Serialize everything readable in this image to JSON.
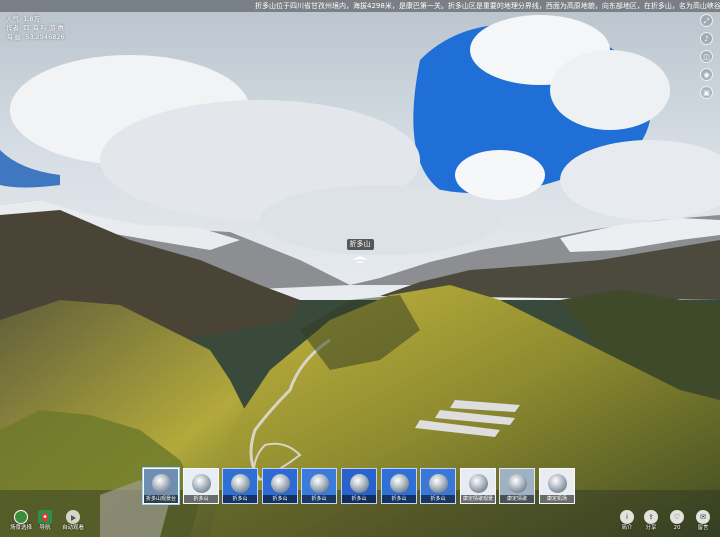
{
  "ticker": {
    "text": "折多山位于四川省甘孜州境内，海拔4298米，是康巴第一关。折多山区是重要的地理分界线，西面为高原地貌，向东部地区，在折多山，名为高山峡谷地貌，有大渡河，大雪山横亘在川西"
  },
  "stats": {
    "views": "人气: 1.8万",
    "author": "作者: 四 海 叫 游 惠",
    "altitude": "海 拔: 53.2946826"
  },
  "right_tools": [
    {
      "icon": "expand-icon",
      "glyph": "⤢"
    },
    {
      "icon": "music-icon",
      "glyph": "♪"
    },
    {
      "icon": "vr-icon",
      "glyph": "◫"
    },
    {
      "icon": "eye-icon",
      "glyph": "◉"
    },
    {
      "icon": "gyroscope-icon",
      "glyph": "▣"
    }
  ],
  "hotspot": {
    "label": "折多山"
  },
  "thumbnails": [
    {
      "label": "折多山观景台",
      "active": true,
      "color": "#6e8fb0"
    },
    {
      "label": "折多山",
      "active": false,
      "color": "#e8eef5"
    },
    {
      "label": "折多山",
      "active": false,
      "color": "#2f6fd6"
    },
    {
      "label": "折多山",
      "active": false,
      "color": "#2d6ad2"
    },
    {
      "label": "折多山",
      "active": false,
      "color": "#3b7bdc"
    },
    {
      "label": "折多山",
      "active": false,
      "color": "#2a62cc"
    },
    {
      "label": "折多山",
      "active": false,
      "color": "#2e6fd8"
    },
    {
      "label": "折多山",
      "active": false,
      "color": "#3a78d8"
    },
    {
      "label": "康定情歌观景",
      "active": false,
      "color": "#e6ecf2"
    },
    {
      "label": "康定情歌",
      "active": false,
      "color": "#9fb2c4"
    },
    {
      "label": "康定机场",
      "active": false,
      "color": "#e9edf1"
    }
  ],
  "bottom_left": [
    {
      "icon": "scene-select-icon",
      "label": "场景选择"
    },
    {
      "icon": "map-icon",
      "label": "导航"
    },
    {
      "icon": "auto-tour-icon",
      "label": "自动观看"
    }
  ],
  "bottom_right": [
    {
      "icon": "info-icon",
      "label": "简介",
      "glyph": "i"
    },
    {
      "icon": "share-icon",
      "label": "分享",
      "glyph": "⇪"
    },
    {
      "icon": "like-icon",
      "label": "20",
      "glyph": "♡"
    },
    {
      "icon": "comment-icon",
      "label": "留言",
      "glyph": "✉"
    }
  ]
}
